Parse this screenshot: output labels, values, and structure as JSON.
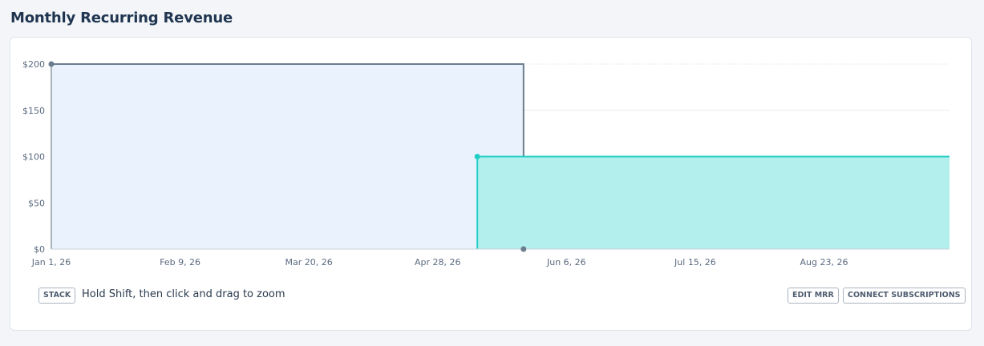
{
  "page": {
    "title": "Monthly Recurring Revenue"
  },
  "controls": {
    "stack_label": "STACK",
    "zoom_hint": "Hold Shift, then click and drag to zoom",
    "edit_label": "EDIT MRR",
    "connect_label": "CONNECT SUBSCRIPTIONS"
  },
  "chart_data": {
    "type": "area",
    "step": true,
    "title": "",
    "xlabel": "",
    "ylabel": "",
    "ylim": [
      0,
      200
    ],
    "y_ticks": [
      0,
      50,
      100,
      150,
      200
    ],
    "y_tick_labels": [
      "$0",
      "$50",
      "$100",
      "$150",
      "$200"
    ],
    "x_range": [
      "2026-01-01",
      "2026-09-30"
    ],
    "x_ticks": [
      "2026-01-01",
      "2026-02-09",
      "2026-03-20",
      "2026-04-28",
      "2026-06-06",
      "2026-07-15",
      "2026-08-23"
    ],
    "x_tick_labels": [
      "Jan 1, 26",
      "Feb 9, 26",
      "Mar 20, 26",
      "Apr 28, 26",
      "Jun 6, 26",
      "Jul 15, 26",
      "Aug 23, 26"
    ],
    "grid": true,
    "series": [
      {
        "color": "#6b7d8e",
        "fill": "#eaf3fd",
        "points": [
          {
            "x": "2026-01-01",
            "y": 200
          },
          {
            "x": "2026-05-24",
            "y": 200
          },
          {
            "x": "2026-05-24",
            "y": 0
          }
        ]
      },
      {
        "color": "#22cfc6",
        "fill": "#b2efed",
        "points": [
          {
            "x": "2026-05-10",
            "y": 100
          },
          {
            "x": "2026-09-30",
            "y": 100
          }
        ]
      }
    ]
  }
}
